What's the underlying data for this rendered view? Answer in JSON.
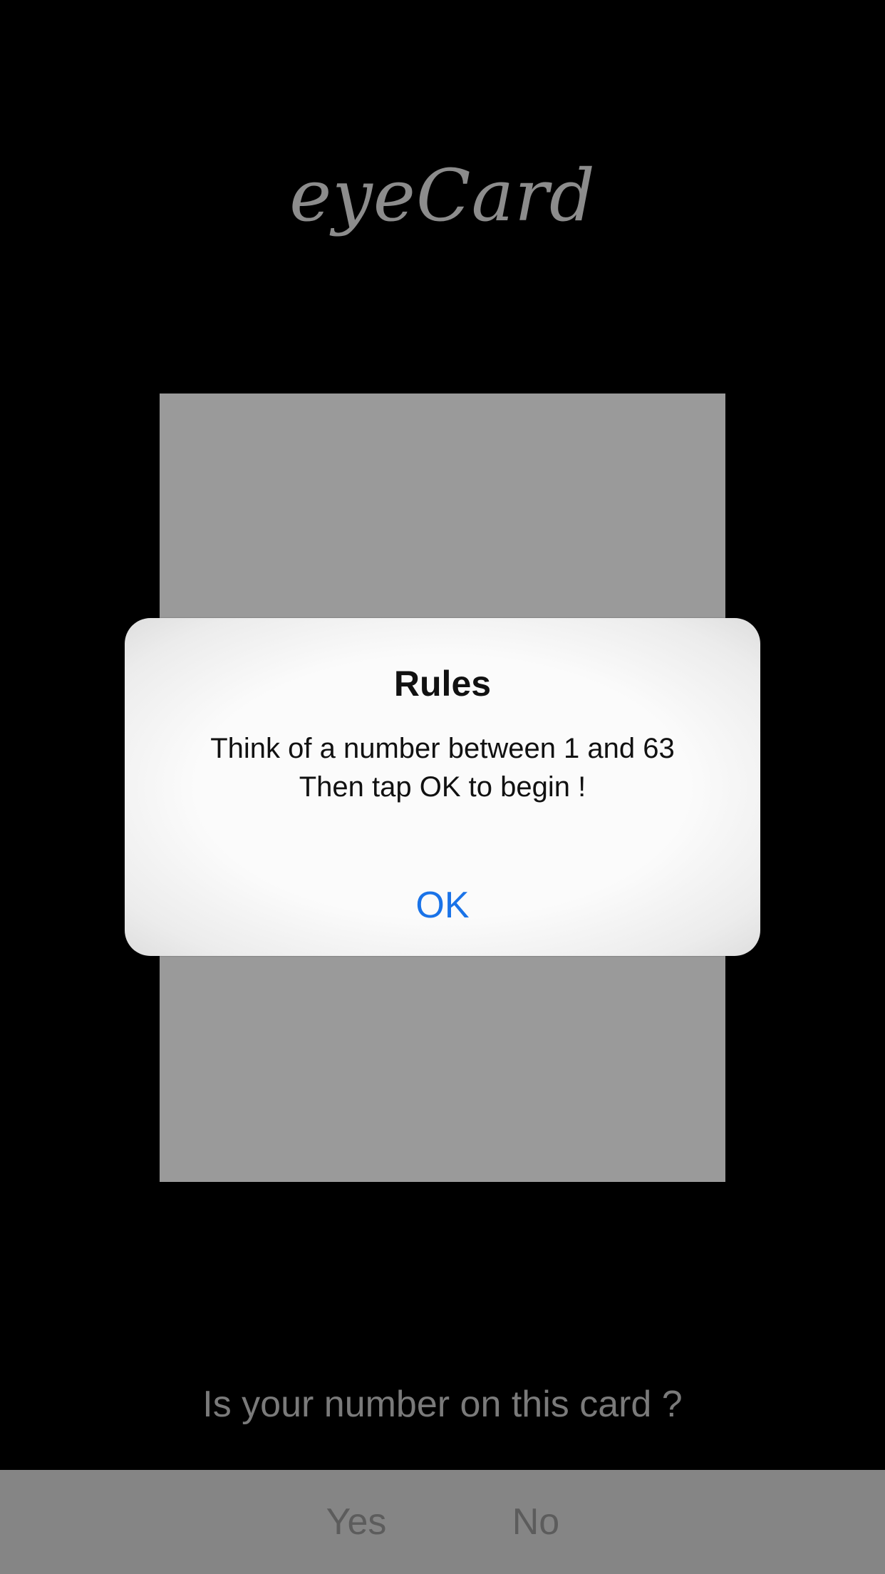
{
  "app": {
    "title": "eyeCard"
  },
  "main": {
    "prompt": "Is your number on this card ?"
  },
  "bottom_bar": {
    "yes_label": "Yes",
    "no_label": "No"
  },
  "alert": {
    "title": "Rules",
    "message_line1": "Think of a number between 1 and 63",
    "message_line2": "Then tap OK to begin !",
    "ok_label": "OK"
  },
  "colors": {
    "background": "#000000",
    "card": "#9a9a9a",
    "alert_button": "#1a73e8"
  }
}
